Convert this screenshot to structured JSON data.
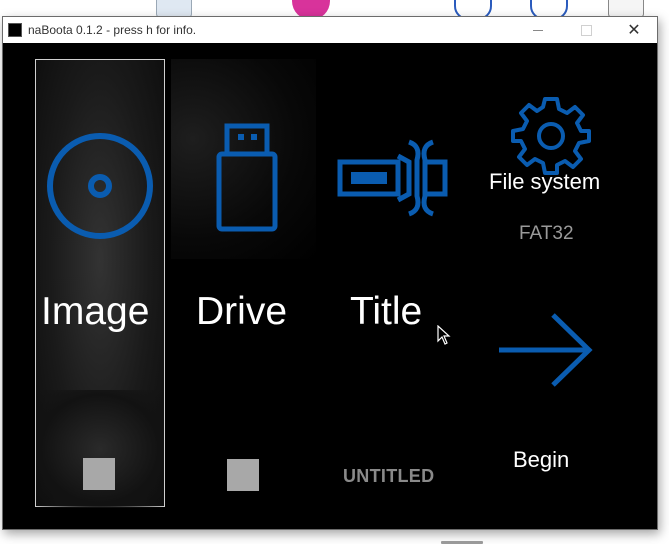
{
  "window": {
    "title": "naBoota 0.1.2 - press h for info.",
    "controls": {
      "minimize": "",
      "maximize": "",
      "close": "✕"
    }
  },
  "tiles": {
    "image": {
      "label": "Image",
      "icon": "disc-icon"
    },
    "drive": {
      "label": "Drive",
      "icon": "usb-drive-icon"
    },
    "title": {
      "label": "Title",
      "value": "UNTITLED",
      "icon": "label-clamp-icon"
    },
    "filesystem": {
      "label": "File system",
      "value": "FAT32",
      "icon": "gear-icon"
    },
    "begin": {
      "label": "Begin",
      "icon": "arrow-right-icon"
    }
  },
  "colors": {
    "accent": "#0a5cb0",
    "background": "#000000",
    "text": "#ffffff",
    "muted_text": "#9a9a9a",
    "status_square": "#a8a8a8"
  }
}
